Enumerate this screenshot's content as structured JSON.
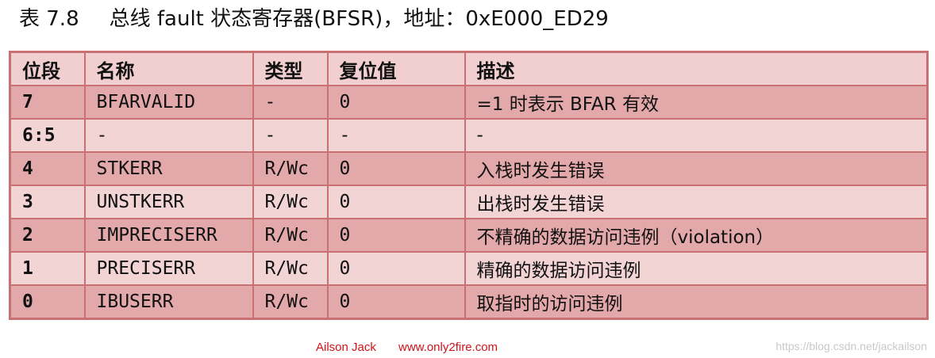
{
  "caption": {
    "number": "表 7.8",
    "title": "总线 fault 状态寄存器(BFSR)，地址：0xE000_ED29"
  },
  "table": {
    "headers": [
      "位段",
      "名称",
      "类型",
      "复位值",
      "描述"
    ],
    "rows": [
      {
        "bit": "7",
        "name": "BFARVALID",
        "type": "-",
        "reset": "0",
        "desc": "=1 时表示 BFAR 有效"
      },
      {
        "bit": "6:5",
        "name": "-",
        "type": "-",
        "reset": "-",
        "desc": "-"
      },
      {
        "bit": "4",
        "name": "STKERR",
        "type": "R/Wc",
        "reset": "0",
        "desc": "入栈时发生错误"
      },
      {
        "bit": "3",
        "name": "UNSTKERR",
        "type": "R/Wc",
        "reset": "0",
        "desc": "出栈时发生错误"
      },
      {
        "bit": "2",
        "name": "IMPRECISERR",
        "type": "R/Wc",
        "reset": "0",
        "desc": "不精确的数据访问违例（violation）"
      },
      {
        "bit": "1",
        "name": "PRECISERR",
        "type": "R/Wc",
        "reset": "0",
        "desc": "精确的数据访问违例"
      },
      {
        "bit": "0",
        "name": "IBUSERR",
        "type": "R/Wc",
        "reset": "0",
        "desc": "取指时的访问违例"
      }
    ]
  },
  "footer": {
    "author": "Ailson Jack",
    "site": "www.only2fire.com",
    "watermark": "https://blog.csdn.net/jackailson"
  },
  "colors": {
    "border": "#c97073",
    "header_bg": "#f1cfd0",
    "row_dark": "#e3a8aa",
    "row_light": "#f2d4d5",
    "credit_red": "#d0131a",
    "watermark_gray": "#c9c9c9"
  }
}
